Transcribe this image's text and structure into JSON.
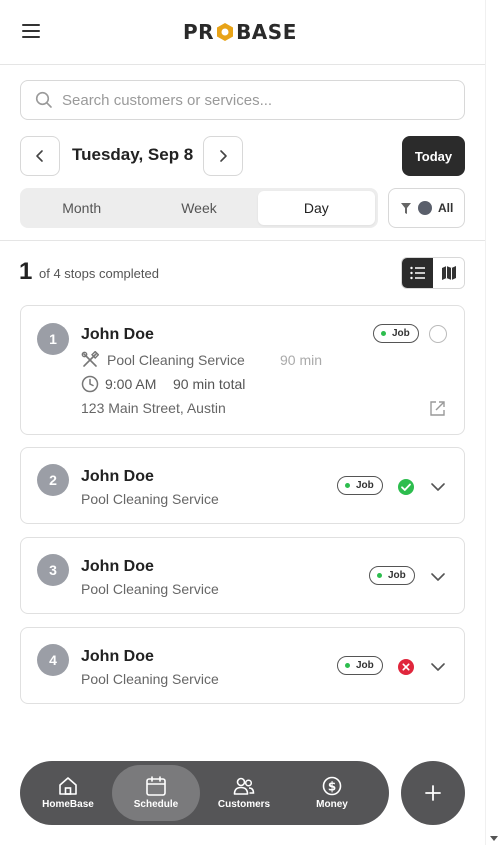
{
  "header": {
    "logo_text_left": "PR",
    "logo_text_right": "BASE"
  },
  "search": {
    "placeholder": "Search customers or services..."
  },
  "date_nav": {
    "date_label": "Tuesday, Sep 8",
    "today_label": "Today"
  },
  "view_toggle": {
    "tabs": [
      {
        "label": "Month"
      },
      {
        "label": "Week"
      },
      {
        "label": "Day"
      }
    ],
    "active": "Day"
  },
  "filter": {
    "label": "All"
  },
  "progress": {
    "completed": "1",
    "text": "of 4 stops completed"
  },
  "stops": [
    {
      "number": "1",
      "name": "John Doe",
      "service": "Pool Cleaning Service",
      "duration": "90 min",
      "time": "9:00 AM",
      "total": "90 min total",
      "address": "123 Main Street, Austin",
      "badge": "Job",
      "status": "pending"
    },
    {
      "number": "2",
      "name": "John Doe",
      "service": "Pool Cleaning Service",
      "badge": "Job",
      "status": "completed"
    },
    {
      "number": "3",
      "name": "John Doe",
      "service": "Pool Cleaning Service",
      "badge": "Job",
      "status": "none"
    },
    {
      "number": "4",
      "name": "John Doe",
      "service": "Pool Cleaning Service",
      "badge": "Job",
      "status": "cancelled"
    }
  ],
  "bottom_nav": {
    "items": [
      {
        "label": "HomeBase",
        "icon": "home-icon"
      },
      {
        "label": "Schedule",
        "icon": "calendar-icon"
      },
      {
        "label": "Customers",
        "icon": "users-icon"
      },
      {
        "label": "Money",
        "icon": "dollar-icon"
      }
    ],
    "active": "Schedule"
  },
  "colors": {
    "accent_dark": "#2b2b2b",
    "logo_gold": "#e8a317",
    "status_green": "#2dbd4e",
    "status_red": "#e0263c",
    "nav_bg": "#555557"
  }
}
